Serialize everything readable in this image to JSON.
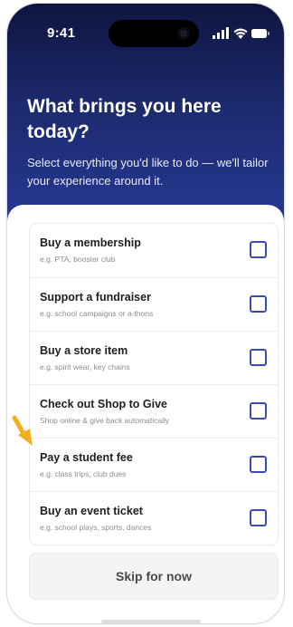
{
  "status_bar": {
    "time": "9:41"
  },
  "header": {
    "title": "What brings you here today?",
    "subtitle": "Select everything you'd like to do — we'll tailor your experience around it."
  },
  "options": [
    {
      "title": "Buy a membership",
      "description": "e.g. PTA, booster club",
      "checked": false
    },
    {
      "title": "Support a fundraiser",
      "description": "e.g. school campaigns or a-thons",
      "checked": false
    },
    {
      "title": "Buy a store item",
      "description": "e.g. spirit wear, key chains",
      "checked": false
    },
    {
      "title": "Check out Shop to Give",
      "description": "Shop online & give back automatically",
      "checked": false
    },
    {
      "title": "Pay a student fee",
      "description": "e.g. class trips, club dues",
      "checked": false
    },
    {
      "title": "Buy an event ticket",
      "description": "e.g. school plays, sports, dances",
      "checked": false
    }
  ],
  "skip_button": {
    "label": "Skip for now"
  },
  "colors": {
    "hero_dark": "#0f1540",
    "hero_light": "#2a3c96",
    "checkbox_border": "#3b4bb6",
    "pointer_arrow": "#f2b01e"
  },
  "icons": [
    "signal-icon",
    "wifi-icon",
    "battery-icon",
    "pointer-arrow-icon"
  ]
}
